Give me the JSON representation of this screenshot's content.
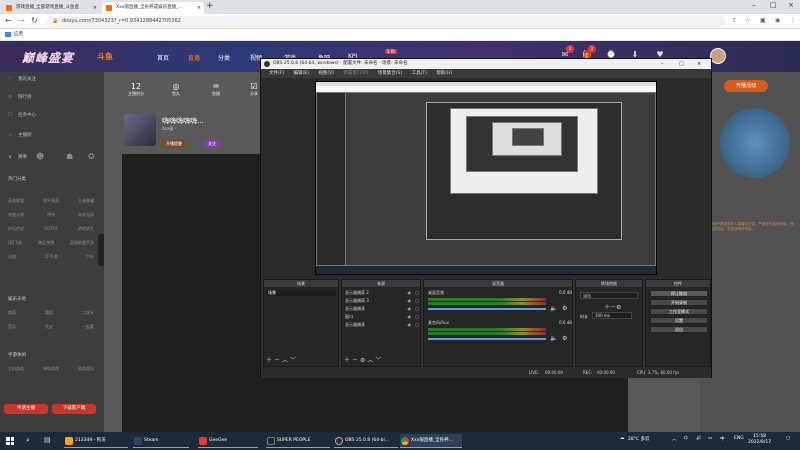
{
  "browser": {
    "tabs": [
      {
        "title": "游戏直播_全部游戏直播_斗鱼直"
      },
      {
        "title": "Xxx丽直播_全民养成娱乐直播_..."
      }
    ],
    "url": "douyu.com/7304323?_r=0.9341288442705362",
    "bookmark": "应用"
  },
  "douyu": {
    "logo_main": "巅峰盛宴",
    "logo_sub": "斗鱼",
    "nav": [
      "首页",
      "直播",
      "分类",
      "视频",
      "游戏",
      "鱼吧",
      "KPI"
    ],
    "nav_badge": "S Kt",
    "header_icons": [
      {
        "name": "message-icon",
        "badge": "1"
      },
      {
        "name": "gift-icon",
        "badge": "1"
      },
      {
        "name": "history-icon",
        "badge": ""
      },
      {
        "name": "download-icon",
        "badge": ""
      },
      {
        "name": "follow-icon",
        "badge": ""
      }
    ],
    "sidebar": {
      "items": [
        "我的关注",
        "排行榜",
        "任务中心",
        "主播榜",
        "赛事"
      ],
      "sections": [
        {
          "head": "热门分类",
          "rows": [
            [
              "英雄联盟",
              "和平精英",
              "王者荣耀"
            ],
            [
              "穿越火线",
              "原神",
              "永劫无间"
            ],
            [
              "炉石传说",
              "DOTA2",
              "绝地求生"
            ],
            [
              "QQ飞车",
              "暗区突围",
              "英雄联盟手游"
            ],
            [
              "问道",
              "CF手游",
              "户外"
            ]
          ]
        },
        {
          "head": "娱乐天地",
          "rows": [
            [
              "颜值",
              "舞蹈",
              "二次元"
            ],
            [
              "音乐",
              "交友",
              "一起看"
            ]
          ]
        },
        {
          "head": "手游休闲",
          "rows": [
            [
              "主机游戏",
              "单机游戏",
              "网游竞技"
            ]
          ]
        }
      ],
      "buttons": [
        "申请主播",
        "下载客户端"
      ]
    },
    "stats": [
      {
        "num": "12",
        "label": "主播积分"
      },
      {
        "num": "",
        "label": "鱼丸"
      },
      {
        "num": "",
        "label": "鱼翅"
      },
      {
        "num": "",
        "label": "分享"
      }
    ],
    "anchor": {
      "name": "嗨嗨嗨嗨嗨...",
      "sub": "Xxx丽 ·",
      "pills": [
        "开播提醒",
        "关注"
      ]
    },
    "promo": {
      "btn": "开播活动",
      "text": "本房间严禁未成年人直播及打赏，严禁任何色情低俗、违法违规内容。发现违规请举报。"
    }
  },
  "obs": {
    "title": "OBS 25.0.8 (64-bit, windows) - 配置文件: 未命名 - 场景: 未命名",
    "menu": [
      "文件(F)",
      "编辑(E)",
      "视图(V)",
      "停靠窗口(D)",
      "场景集合(S)",
      "工具(T)",
      "帮助(H)"
    ],
    "docks": {
      "scenes": {
        "title": "场景",
        "items": [
          "场景"
        ]
      },
      "sources": {
        "title": "来源",
        "items": [
          "显示器捕获 2",
          "显示器捕获 3",
          "显示器捕获",
          "窗口",
          "显示器捕获"
        ]
      },
      "mixer": {
        "title": "混音器",
        "channels": [
          {
            "name": "桌面音频",
            "db": "0.0 dB"
          },
          {
            "name": "麦克风/Aux",
            "db": "0.0 dB"
          }
        ]
      },
      "transitions": {
        "title": "转场特效",
        "type": "淡出",
        "duration_label": "时长",
        "duration": "300 ms"
      },
      "controls": {
        "title": "控件",
        "buttons": [
          "停止推流",
          "开始录制",
          "工作室模式",
          "设置",
          "退出"
        ]
      }
    },
    "status": {
      "live": "LIVE:",
      "live_time": "00:00:00",
      "rec": "REC:",
      "rec_time": "00:00:00",
      "cpu": "CPU: 3.7%, 60.00 fps"
    }
  },
  "taskbar": {
    "apps": [
      {
        "label": "213349 - 狗沃",
        "color": "#ffa21a"
      },
      {
        "label": "Steam",
        "color": "#2a475e"
      },
      {
        "label": "GeeGee",
        "color": "#e03a3a"
      },
      {
        "label": "SUPER PEOPLE",
        "color": "#222"
      },
      {
        "label": "OBS 25.0.8 (64-bi...",
        "color": "#333"
      },
      {
        "label": "Xxx丽直播_全民养...",
        "color": "#ffffff"
      }
    ],
    "weather": "28°C 多云",
    "lang": "ENG",
    "time": "15:58",
    "date": "2022/8/17"
  }
}
